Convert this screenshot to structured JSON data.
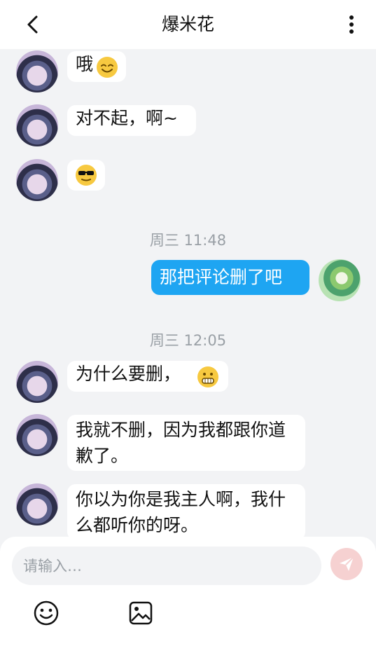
{
  "header": {
    "title": "爆米花",
    "back_icon": "chevron-left-icon",
    "more_icon": "more-vertical-icon"
  },
  "messages": [
    {
      "side": "left",
      "text": "哦",
      "emoji": "smile-emoji"
    },
    {
      "side": "left",
      "text": "对不起，啊~"
    },
    {
      "side": "left",
      "text": "",
      "emoji": "sunglasses-emoji"
    },
    {
      "side": "time",
      "text": "周三 11:48"
    },
    {
      "side": "right",
      "text": "那把评论删了吧"
    },
    {
      "side": "time",
      "text": "周三 12:05"
    },
    {
      "side": "left",
      "text": "为什么要删，",
      "emoji": "grin-emoji"
    },
    {
      "side": "left",
      "text": "我就不删，因为我都跟你道歉了。"
    },
    {
      "side": "left",
      "text": "你以为你是我主人啊，我什么都听你的呀。"
    }
  ],
  "composer": {
    "placeholder": "请输入…",
    "send_icon": "send-icon",
    "emoji_icon": "emoji-icon",
    "image_icon": "image-icon"
  },
  "colors": {
    "accent": "#1ea5f2",
    "send_button": "#f6d1d1"
  }
}
